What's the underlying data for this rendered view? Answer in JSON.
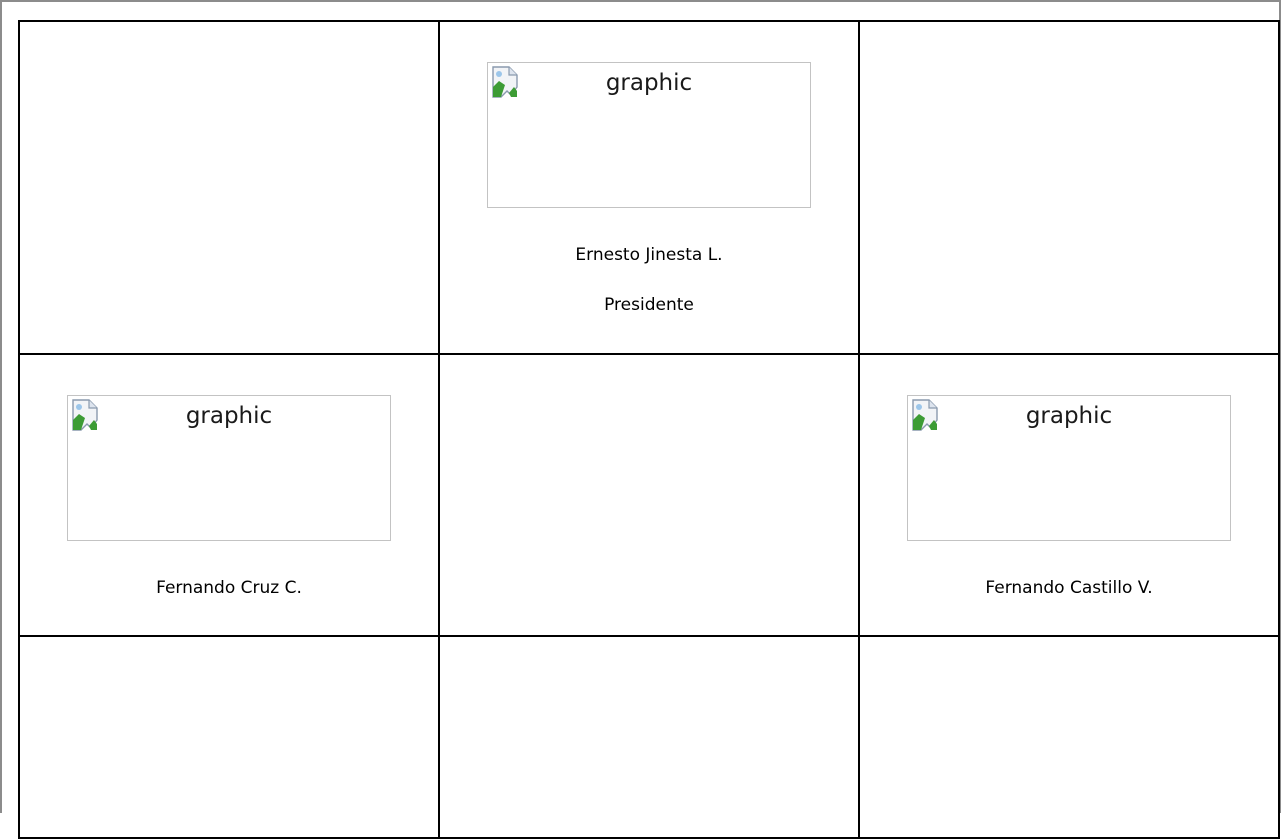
{
  "signatures": {
    "row1": {
      "center": {
        "image_alt": "graphic",
        "name": "Ernesto Jinesta L.",
        "role": "Presidente"
      }
    },
    "row2": {
      "left": {
        "image_alt": "graphic",
        "name": "Fernando Cruz C."
      },
      "right": {
        "image_alt": "graphic",
        "name": "Fernando Castillo V."
      }
    }
  },
  "icons": {
    "placeholder_image": "broken-image-icon"
  }
}
